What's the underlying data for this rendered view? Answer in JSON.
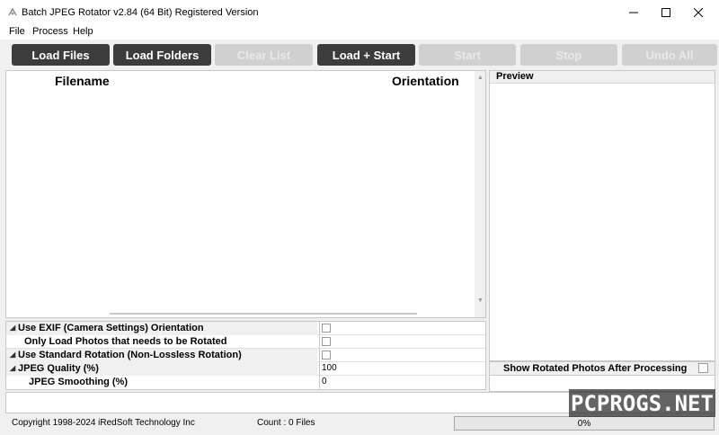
{
  "window": {
    "title": "Batch JPEG Rotator v2.84 (64 Bit) Registered Version",
    "icon": "app-icon"
  },
  "menu": [
    "File",
    "Process",
    "Help"
  ],
  "toolbar": {
    "load_files": "Load Files",
    "load_folders": "Load Folders",
    "clear_list": "Clear List",
    "load_start": "Load + Start",
    "start": "Start",
    "stop": "Stop",
    "undo_all": "Undo All"
  },
  "file_list": {
    "columns": [
      "Filename",
      "Orientation"
    ],
    "rows": []
  },
  "preview": {
    "title": "Preview",
    "show_rotated_label": "Show Rotated Photos After Processing",
    "show_rotated_checked": false
  },
  "options": [
    {
      "label": "Use EXIF (Camera Settings) Orientation",
      "value": "",
      "type": "checkbox",
      "category": true
    },
    {
      "label": "Only Load Photos that needs to be Rotated",
      "value": "",
      "type": "checkbox",
      "category": false
    },
    {
      "label": "Use Standard Rotation (Non-Lossless Rotation)",
      "value": "",
      "type": "checkbox",
      "category": true
    },
    {
      "label": "JPEG Quality (%)",
      "value": "100",
      "type": "text",
      "category": true
    },
    {
      "label": "JPEG Smoothing (%)",
      "value": "0",
      "type": "text",
      "category": false
    }
  ],
  "status": {
    "copyright": "Copyright 1998-2024 iRedSoft Technology Inc",
    "count": "Count : 0 Files",
    "progress_text": "0%",
    "progress": 0
  },
  "watermark": "PCPROGS.NET",
  "colors": {
    "button_dark": "#3c3c3c",
    "button_disabled": "#d0d0d0",
    "progress_fill": "#06b025"
  }
}
